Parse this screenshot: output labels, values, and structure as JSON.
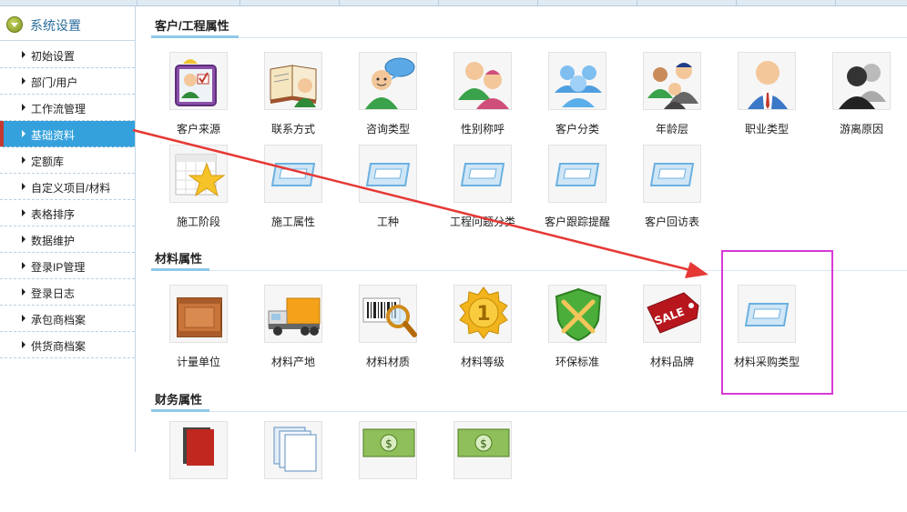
{
  "sidebar": {
    "title": "系统设置",
    "items": [
      {
        "label": "初始设置"
      },
      {
        "label": "部门/用户"
      },
      {
        "label": "工作流管理"
      },
      {
        "label": "基础资料",
        "active": true
      },
      {
        "label": "定额库"
      },
      {
        "label": "自定义项目/材料"
      },
      {
        "label": "表格排序"
      },
      {
        "label": "数据维护"
      },
      {
        "label": "登录IP管理"
      },
      {
        "label": "登录日志"
      },
      {
        "label": "承包商档案"
      },
      {
        "label": "供货商档案"
      }
    ]
  },
  "sections": [
    {
      "title": "客户/工程属性",
      "rows": [
        [
          {
            "label": "客户来源",
            "icon": "survey-person-icon"
          },
          {
            "label": "联系方式",
            "icon": "contact-book-icon"
          },
          {
            "label": "咨询类型",
            "icon": "consult-chat-icon"
          },
          {
            "label": "性别称呼",
            "icon": "gender-pair-icon"
          },
          {
            "label": "客户分类",
            "icon": "customer-group-icon"
          },
          {
            "label": "年龄层",
            "icon": "age-group-icon"
          },
          {
            "label": "职业类型",
            "icon": "occupation-person-icon"
          },
          {
            "label": "游离原因",
            "icon": "users-dark-icon"
          }
        ],
        [
          {
            "label": "施工阶段",
            "icon": "calendar-star-icon"
          },
          {
            "label": "施工属性",
            "icon": "placeholder-card-icon"
          },
          {
            "label": "工种",
            "icon": "placeholder-card-icon"
          },
          {
            "label": "工程问题分类",
            "icon": "placeholder-card-icon"
          },
          {
            "label": "客户跟踪提醒",
            "icon": "placeholder-card-icon"
          },
          {
            "label": "客户回访表",
            "icon": "placeholder-card-icon"
          }
        ]
      ]
    },
    {
      "title": "材料属性",
      "rows": [
        [
          {
            "label": "计量单位",
            "icon": "wooden-crate-icon"
          },
          {
            "label": "材料产地",
            "icon": "delivery-truck-icon"
          },
          {
            "label": "材料材质",
            "icon": "barcode-magnifier-icon"
          },
          {
            "label": "材料等级",
            "icon": "gold-medal-icon"
          },
          {
            "label": "环保标准",
            "icon": "green-shield-icon"
          },
          {
            "label": "材料品牌",
            "icon": "sale-tag-icon"
          },
          {
            "label": "材料采购类型",
            "icon": "placeholder-card-icon"
          }
        ]
      ]
    },
    {
      "title": "财务属性",
      "rows": [
        [
          {
            "label": "",
            "icon": "red-books-icon"
          },
          {
            "label": "",
            "icon": "document-stack-icon"
          },
          {
            "label": "",
            "icon": "money-bills-icon"
          },
          {
            "label": "",
            "icon": "money-bills-icon"
          }
        ]
      ]
    }
  ],
  "colors": {
    "sidebar_active_bg": "#35a1dc",
    "sidebar_active_marker": "#c4392f",
    "annotation_arrow": "#e53935",
    "annotation_box": "#d63ad6"
  }
}
